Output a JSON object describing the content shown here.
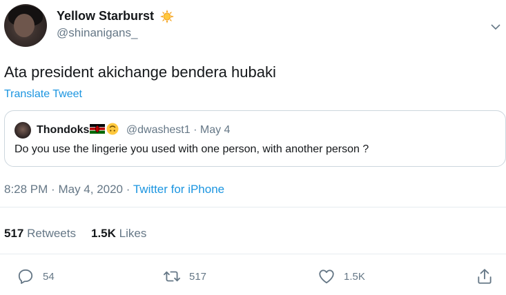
{
  "author": {
    "display_name": "Yellow Starburst",
    "handle": "@shinanigans_",
    "badge_icon": "sun-emoji-icon"
  },
  "tweet": {
    "text": "Ata president akichange bendera hubaki",
    "translate_label": "Translate Tweet"
  },
  "quoted": {
    "name": "Thondoks",
    "flag_icon": "kenya-flag-icon",
    "emoji_icon": "upside-down-face-icon",
    "handle": "@dwashest1",
    "separator": "·",
    "date": "May 4",
    "text": "Do you use the lingerie you used with one person, with another person ?"
  },
  "meta": {
    "time": "8:28 PM",
    "separator": "·",
    "date": "May 4, 2020",
    "source": "Twitter for iPhone"
  },
  "stats": {
    "retweets_count": "517",
    "retweets_label": "Retweets",
    "likes_count": "1.5K",
    "likes_label": "Likes"
  },
  "actions": {
    "reply_count": "54",
    "retweet_count": "517",
    "like_count": "1.5K"
  },
  "colors": {
    "link": "#1b95e0",
    "secondary_text": "#657786",
    "border": "#ccd6dd"
  }
}
